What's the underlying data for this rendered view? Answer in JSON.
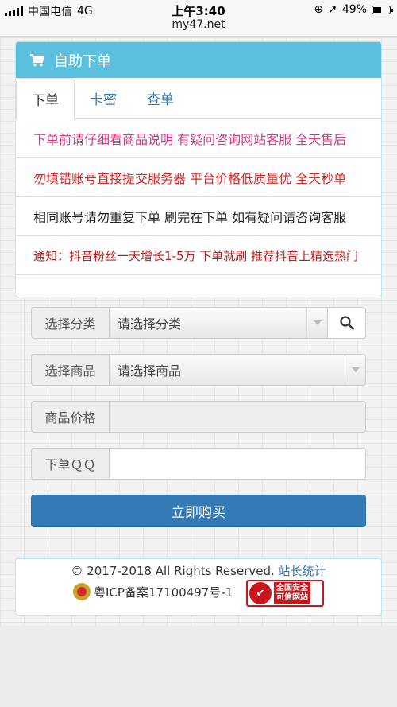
{
  "status_bar": {
    "carrier": "中国电信",
    "network": "4G",
    "time": "上午3:40",
    "url": "my47.net",
    "battery": "49%",
    "battery_level": 0.49
  },
  "panel": {
    "title": "自助下单",
    "tabs": [
      "下单",
      "卡密",
      "查单"
    ],
    "notices": [
      "下单前请仔细看商品说明 有疑问咨询网站客服 全天售后",
      "勿填错账号直接提交服务器 平台价格低质量优 全天秒单",
      "相同账号请勿重复下单 刷完在下单 如有疑问请咨询客服",
      "通知：抖音粉丝一天增长1-5万 下单就刷 推荐抖音上精选热门"
    ]
  },
  "form": {
    "category_label": "选择分类",
    "category_value": "请选择分类",
    "product_label": "选择商品",
    "product_value": "请选择商品",
    "price_label": "商品价格",
    "price_value": "",
    "qq_label": "下单ＱＱ",
    "qq_value": "",
    "buy_label": "立即购买"
  },
  "footer": {
    "copyright": "© 2017-2018 All Rights Reserved.",
    "stats_link": "站长统计",
    "icp": "粤ICP备案17100497号-1",
    "badge_text_1": "全国安全",
    "badge_text_2": "可信网站"
  },
  "colors": {
    "header": "#5bc0de",
    "primary": "#337ab7",
    "notice_pink": "#e0337e",
    "notice_red": "#e82020"
  }
}
